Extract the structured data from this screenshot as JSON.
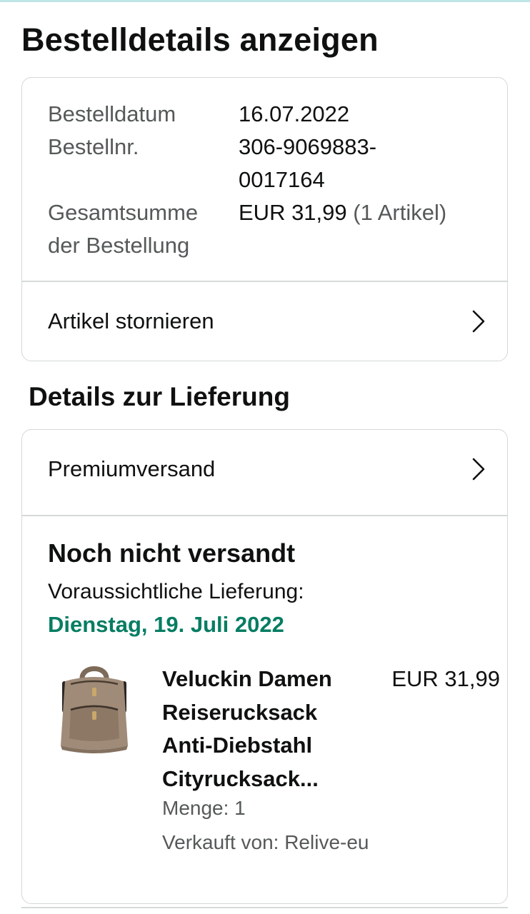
{
  "page": {
    "title": "Bestelldetails anzeigen"
  },
  "order": {
    "date_label": "Bestelldatum",
    "date_value": "16.07.2022",
    "number_label": "Bestellnr.",
    "number_value_line1": "306-9069883-",
    "number_value_line2": "0017164",
    "total_label_line1": "Gesamtsumme",
    "total_label_line2": "der Bestellung",
    "total_value": "EUR 31,99",
    "total_count": "(1 Artikel)",
    "cancel_label": "Artikel stornieren"
  },
  "delivery": {
    "section_title": "Details zur Lieferung",
    "shipping_method": "Premiumversand",
    "status": "Noch nicht versandt",
    "eta_label": "Voraussichtliche Lieferung:",
    "eta_date": "Dienstag, 19. Juli 2022",
    "eta_color": "#067d62",
    "item": {
      "title_lines": [
        "Veluckin Damen",
        "Reiserucksack",
        "Anti-Diebstahl",
        "Cityrucksack..."
      ],
      "price": "EUR 31,99",
      "quantity": "Menge: 1",
      "seller": "Verkauft von: Relive-eu",
      "image": "backpack-image"
    }
  },
  "icons": {
    "chevron": "chevron-right-icon"
  }
}
